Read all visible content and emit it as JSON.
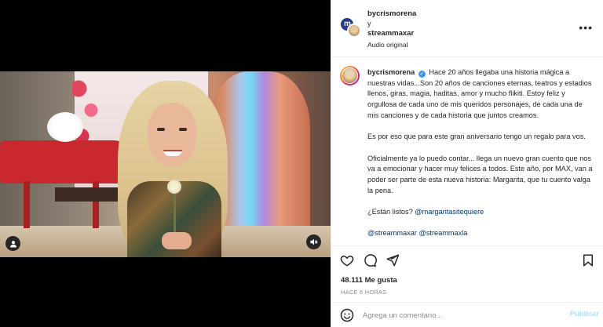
{
  "media": {
    "user_icon": "person-icon",
    "mute_icon": "speaker-muted-icon"
  },
  "header": {
    "user1": "bycrismorena",
    "joiner": "y",
    "user2": "streammaxar",
    "audio": "Audio original",
    "more_icon": "more-horizontal-icon"
  },
  "caption": {
    "username": "bycrismorena",
    "verified_icon": "verified-badge-icon",
    "p1": "Hace 20 años llegaba una historia mágica a nuestras vidas...Son 20 años de canciones eternas, teatros y estadios llenos, giras, magia, haditas, amor y mucho flikiti. Estoy feliz y orgullosa de cada uno de mis queridos personajes, de cada una de mis canciones y de cada historia que juntos creamos.",
    "p2": "Es por eso que para este gran aniversario tengo un regalo para vos.",
    "p3": "Oficialmente ya lo puedo contar... llega un nuevo gran cuento que nos va a emocionar y hacer muy felices a todos. Este año, por MAX, van a poder ser parte de esta nueva historia: Margarita, que tu cuento valga la pena.",
    "p4_text": "¿Están listos?",
    "p4_mention": "@margaritasitequiere",
    "p5_mention1": "@streammaxar",
    "p5_mention2": "@streammaxla"
  },
  "actions": {
    "like_icon": "heart-icon",
    "comment_icon": "comment-icon",
    "share_icon": "share-icon",
    "save_icon": "bookmark-icon",
    "likes": "48.111 Me gusta",
    "time": "HACE 6 HORAS"
  },
  "comment": {
    "emoji_icon": "emoji-icon",
    "placeholder": "Agrega un comentario...",
    "post": "Publicar"
  },
  "colors": {
    "accent": "#0095f6",
    "post_disabled": "#b2dffc",
    "mention": "#00376b",
    "verified": "#3897f0"
  }
}
